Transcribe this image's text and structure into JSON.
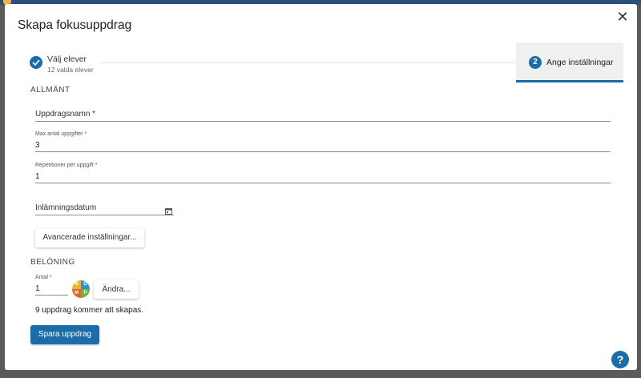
{
  "dialog": {
    "title": "Skapa fokusuppdrag",
    "close_glyph": "✕"
  },
  "stepper": {
    "step1": {
      "label": "Välj elever",
      "sublabel": "12 valda elever",
      "state": "completed"
    },
    "step2": {
      "number": "2",
      "label": "Ange inställningar",
      "state": "active"
    }
  },
  "general": {
    "section_title": "ALLMÄNT",
    "assignment_name": {
      "label": "Uppdragsnamn *",
      "value": ""
    },
    "max_tasks": {
      "label": "Max antal uppgifter *",
      "value": "3"
    },
    "repetitions": {
      "label": "Repetitioner per uppgift *",
      "value": "1"
    },
    "due_date": {
      "placeholder": "Inlämningsdatum",
      "icon": "calendar-icon"
    },
    "advanced_button": "Avancerade inställningar..."
  },
  "reward": {
    "section_title": "BELÖNING",
    "amount": {
      "label": "Antal *",
      "value": "1"
    },
    "coin_letters": [
      "N",
      "O",
      "M",
      "P"
    ],
    "change_button": "Ändra..."
  },
  "summary_text": "9 uppdrag kommer att skapas.",
  "save_button": "Spara uppdrag",
  "help_glyph": "?",
  "colors": {
    "primary": "#1b6ca8",
    "coin_top_left": "#e8b530",
    "coin_top_right": "#3a8fd1",
    "coin_bottom_left": "#e0632c",
    "coin_bottom_right": "#6cb33f"
  }
}
